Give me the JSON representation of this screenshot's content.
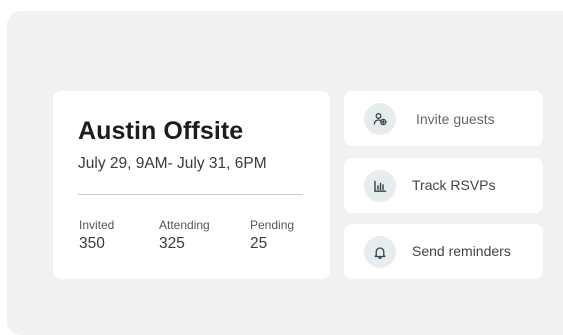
{
  "event": {
    "title": "Austin Offsite",
    "dates": "July 29, 9AM- July 31, 6PM",
    "stats": [
      {
        "label": "Invited",
        "value": "350"
      },
      {
        "label": "Attending",
        "value": "325"
      },
      {
        "label": "Pending",
        "value": "25"
      }
    ]
  },
  "actions": [
    {
      "label": "Invite guests",
      "icon": "add-user-icon"
    },
    {
      "label": "Track RSVPs",
      "icon": "bar-chart-icon"
    },
    {
      "label": "Send reminders",
      "icon": "bell-icon"
    }
  ],
  "colors": {
    "background": "#f1f1f1",
    "card": "#ffffff",
    "icon_circle": "#e7ecef",
    "icon_stroke": "#33424d"
  }
}
